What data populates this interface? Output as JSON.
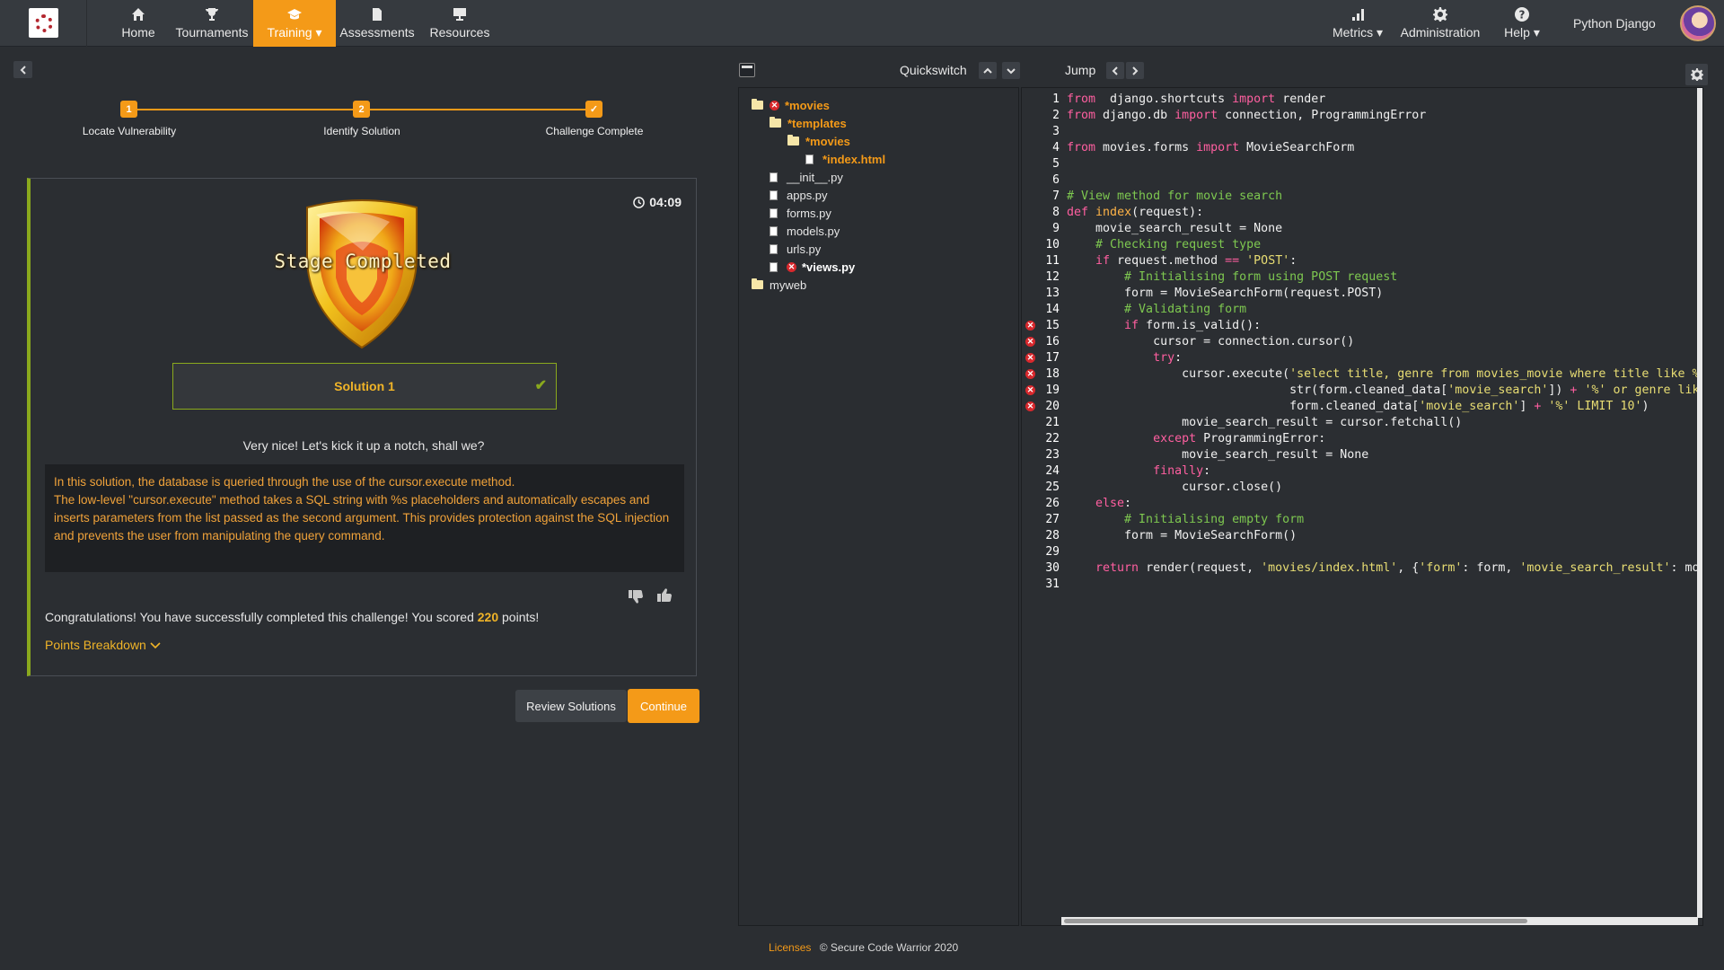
{
  "nav": {
    "items": [
      {
        "label": "Home",
        "icon": "home-icon"
      },
      {
        "label": "Tournaments",
        "icon": "trophy-icon"
      },
      {
        "label": "Training ▾",
        "icon": "graduation-cap-icon",
        "active": true
      },
      {
        "label": "Assessments",
        "icon": "document-icon"
      },
      {
        "label": "Resources",
        "icon": "presentation-icon"
      }
    ],
    "right_items": [
      {
        "label": "Metrics ▾",
        "icon": "bar-chart-icon"
      },
      {
        "label": "Administration",
        "icon": "gear-icon"
      },
      {
        "label": "Help ▾",
        "icon": "question-icon"
      }
    ],
    "user_name": "Python Django",
    "accent_color": "#f49a18"
  },
  "stepper": {
    "steps": [
      {
        "marker": "1",
        "label": "Locate Vulnerability"
      },
      {
        "marker": "2",
        "label": "Identify Solution"
      },
      {
        "marker": "✓",
        "label": "Challenge Complete"
      }
    ]
  },
  "result": {
    "timer": "04:09",
    "badge_text": "Stage Completed",
    "solution_title": "Solution 1",
    "nice_text": "Very nice! Let's kick it up a notch, shall we?",
    "explanation": "In this solution, the database is queried through the use of the cursor.execute method.\nThe low-level \"cursor.execute\" method takes a SQL string with %s placeholders and automatically escapes and inserts parameters from the list passed as the second argument. This provides protection against the SQL injection and prevents the user from manipulating the query command.",
    "congrats_prefix": "Congratulations! You have successfully completed this challenge! You scored ",
    "score": "220",
    "congrats_suffix": " points!",
    "points_breakdown": "Points Breakdown",
    "card_accent": "#8aa91d"
  },
  "actions": {
    "review": "Review Solutions",
    "continue": "Continue"
  },
  "toolbar": {
    "quickswitch": "Quickswitch",
    "jump": "Jump"
  },
  "file_tree": [
    {
      "name": "*movies",
      "type": "folder",
      "depth": 0,
      "modified": true,
      "error": true
    },
    {
      "name": "*templates",
      "type": "folder",
      "depth": 1,
      "modified": true
    },
    {
      "name": "*movies",
      "type": "folder",
      "depth": 2,
      "modified": true
    },
    {
      "name": "*index.html",
      "type": "file",
      "depth": 3,
      "modified": true
    },
    {
      "name": "__init__.py",
      "type": "file",
      "depth": 1
    },
    {
      "name": "apps.py",
      "type": "file",
      "depth": 1
    },
    {
      "name": "forms.py",
      "type": "file",
      "depth": 1
    },
    {
      "name": "models.py",
      "type": "file",
      "depth": 1
    },
    {
      "name": "urls.py",
      "type": "file",
      "depth": 1
    },
    {
      "name": "*views.py",
      "type": "file",
      "depth": 1,
      "error": true,
      "bold": true
    },
    {
      "name": "myweb",
      "type": "folder",
      "depth": 0
    }
  ],
  "code": {
    "error_lines": [
      15,
      16,
      17,
      18,
      19,
      20
    ],
    "lines": [
      [
        [
          "kw",
          "from"
        ],
        [
          "",
          "  django.shortcuts "
        ],
        [
          "kw",
          "import"
        ],
        [
          "",
          " render"
        ]
      ],
      [
        [
          "kw",
          "from"
        ],
        [
          "",
          " django.db "
        ],
        [
          "kw",
          "import"
        ],
        [
          "",
          " connection, ProgrammingError"
        ]
      ],
      [],
      [
        [
          "kw",
          "from"
        ],
        [
          "",
          " movies.forms "
        ],
        [
          "kw",
          "import"
        ],
        [
          "",
          " MovieSearchForm"
        ]
      ],
      [],
      [],
      [
        [
          "cm",
          "# View method for movie search"
        ]
      ],
      [
        [
          "kw",
          "def"
        ],
        [
          "",
          " "
        ],
        [
          "fn",
          "index"
        ],
        [
          "",
          "(request):"
        ]
      ],
      [
        [
          "",
          "    movie_search_result = None"
        ]
      ],
      [
        [
          "cm",
          "    # Checking request type"
        ]
      ],
      [
        [
          "kw",
          "    if"
        ],
        [
          "",
          " request.method "
        ],
        [
          "kw",
          "=="
        ],
        [
          "",
          " "
        ],
        [
          "st",
          "'POST'"
        ],
        [
          "",
          ":"
        ]
      ],
      [
        [
          "cm",
          "        # Initialising form using POST request"
        ]
      ],
      [
        [
          "",
          "        form = MovieSearchForm(request.POST)"
        ]
      ],
      [
        [
          "cm",
          "        # Validating form"
        ]
      ],
      [
        [
          "kw",
          "        if"
        ],
        [
          "",
          " form.is_valid():"
        ]
      ],
      [
        [
          "",
          "            cursor = connection.cursor()"
        ]
      ],
      [
        [
          "kw",
          "            try"
        ],
        [
          "",
          ":"
        ]
      ],
      [
        [
          "",
          "                cursor.execute("
        ],
        [
          "st",
          "'select title, genre from movies_movie where title like %s"
        ]
      ],
      [
        [
          "",
          "                               str(form.cleaned_data["
        ],
        [
          "st",
          "'movie_search'"
        ],
        [
          "",
          "]) "
        ],
        [
          "kw",
          "+"
        ],
        [
          "",
          " "
        ],
        [
          "st",
          "'%' or genre like %s"
        ]
      ],
      [
        [
          "",
          "                               form.cleaned_data["
        ],
        [
          "st",
          "'movie_search'"
        ],
        [
          "",
          "] "
        ],
        [
          "kw",
          "+"
        ],
        [
          "",
          " "
        ],
        [
          "st",
          "'%' LIMIT 10'"
        ],
        [
          "",
          ")"
        ]
      ],
      [
        [
          "",
          "                movie_search_result = cursor.fetchall()"
        ]
      ],
      [
        [
          "kw",
          "            except"
        ],
        [
          "",
          " ProgrammingError:"
        ]
      ],
      [
        [
          "",
          "                movie_search_result = None"
        ]
      ],
      [
        [
          "kw",
          "            finally"
        ],
        [
          "",
          ":"
        ]
      ],
      [
        [
          "",
          "                cursor.close()"
        ]
      ],
      [
        [
          "kw",
          "    else"
        ],
        [
          "",
          ":"
        ]
      ],
      [
        [
          "cm",
          "        # Initialising empty form"
        ]
      ],
      [
        [
          "",
          "        form = MovieSearchForm()"
        ]
      ],
      [],
      [
        [
          "kw",
          "    return"
        ],
        [
          "",
          " render(request, "
        ],
        [
          "st",
          "'movies/index.html'"
        ],
        [
          "",
          ", {"
        ],
        [
          "st",
          "'form'"
        ],
        [
          "",
          ": form, "
        ],
        [
          "st",
          "'movie_search_result'"
        ],
        [
          "",
          ": movie_search_result})"
        ]
      ],
      []
    ]
  },
  "footer": {
    "licenses": "Licenses",
    "copyright": "© Secure Code Warrior 2020"
  }
}
